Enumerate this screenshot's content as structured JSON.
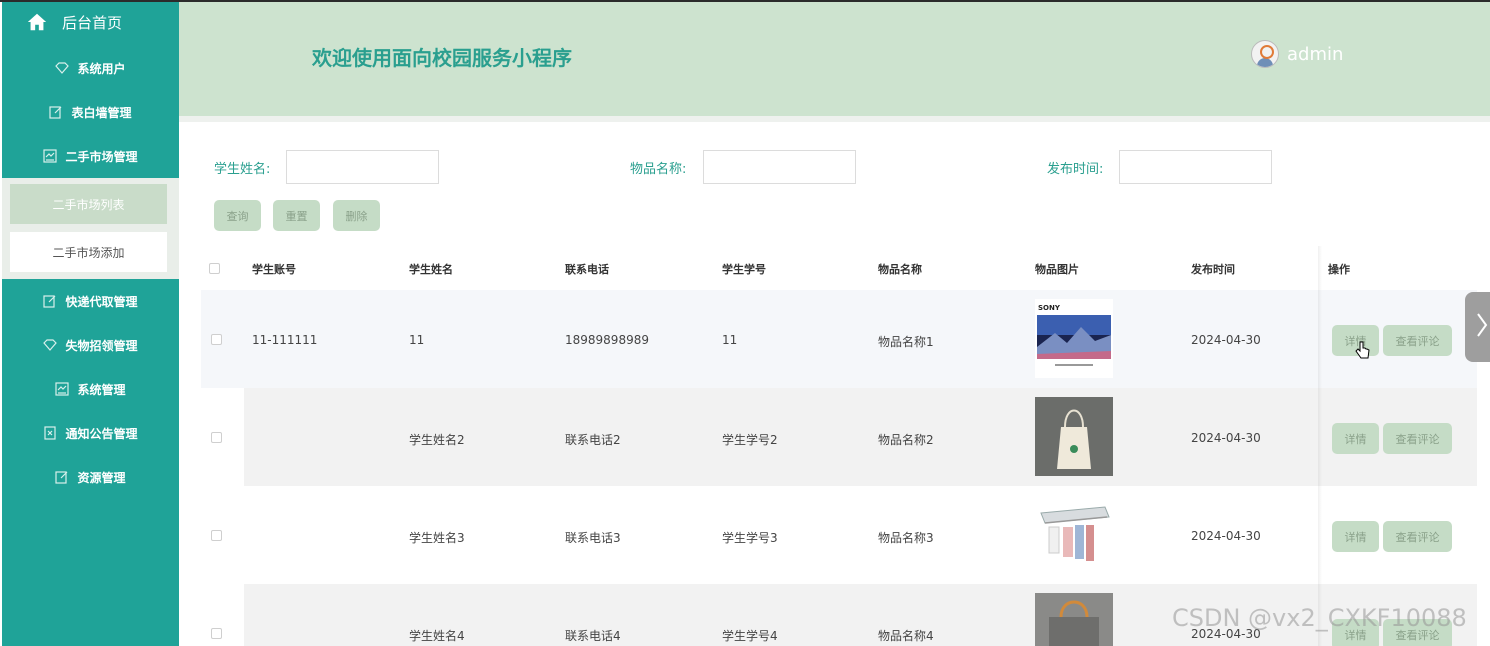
{
  "sidebar": {
    "home": "后台首页",
    "items": [
      {
        "label": "系统用户",
        "icon": "diamond-icon"
      },
      {
        "label": "表白墙管理",
        "icon": "edit-icon"
      },
      {
        "label": "二手市场管理",
        "icon": "chart-icon"
      },
      {
        "label": "快递代取管理",
        "icon": "edit-icon"
      },
      {
        "label": "失物招领管理",
        "icon": "diamond-icon"
      },
      {
        "label": "系统管理",
        "icon": "chart-icon"
      },
      {
        "label": "通知公告管理",
        "icon": "doc-icon"
      },
      {
        "label": "资源管理",
        "icon": "edit-icon"
      }
    ],
    "subitems": [
      "二手市场列表",
      "二手市场添加"
    ]
  },
  "header": {
    "title": "欢迎使用面向校园服务小程序",
    "user": "admin"
  },
  "filters": {
    "student_name_label": "学生姓名:",
    "item_name_label": "物品名称:",
    "publish_time_label": "发布时间:",
    "student_name_value": "",
    "item_name_value": "",
    "publish_time_value": ""
  },
  "actions": {
    "query": "查询",
    "reset": "重置",
    "delete": "删除"
  },
  "table": {
    "headers": [
      "学生账号",
      "学生姓名",
      "联系电话",
      "学生学号",
      "物品名称",
      "物品图片",
      "发布时间",
      "操作"
    ],
    "rows": [
      {
        "account": "11-111111",
        "name": "11",
        "phone": "18989898989",
        "student_no": "11",
        "item": "物品名称1",
        "image": "tv-image",
        "time": "2024-04-30"
      },
      {
        "account": "",
        "name": "学生姓名2",
        "phone": "联系电话2",
        "student_no": "学生学号2",
        "item": "物品名称2",
        "image": "tote-bag-image",
        "time": "2024-04-30"
      },
      {
        "account": "",
        "name": "学生姓名3",
        "phone": "联系电话3",
        "student_no": "学生学号3",
        "item": "物品名称3",
        "image": "clothes-rack-image",
        "time": "2024-04-30"
      },
      {
        "account": "",
        "name": "学生姓名4",
        "phone": "联系电话4",
        "student_no": "学生学号4",
        "item": "物品名称4",
        "image": "felt-bag-image",
        "time": "2024-04-30"
      }
    ],
    "row_actions": {
      "detail": "详情",
      "comments": "查看评论"
    }
  },
  "tv_brand": "SONY",
  "watermark": "CSDN @vx2_CXKF10088",
  "colors": {
    "sidebar": "#1fa398",
    "header": "#cde3cf",
    "accent": "#2a9f8f",
    "button": "#c5dcc6"
  }
}
